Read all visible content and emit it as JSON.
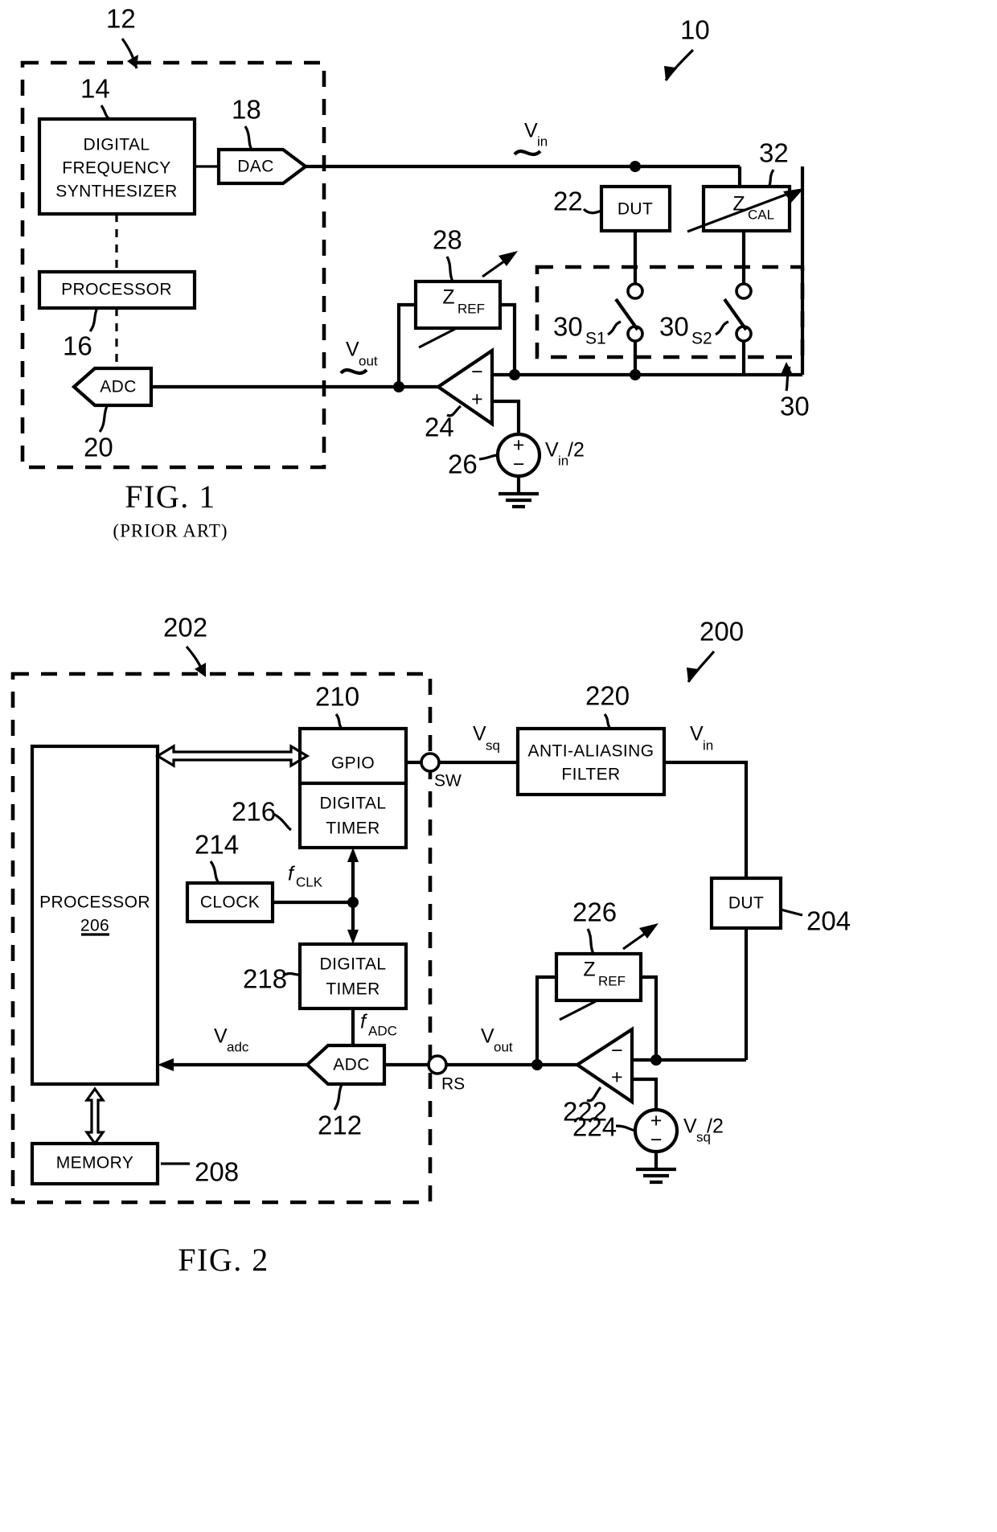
{
  "document": {
    "type": "patent-figure-sheet",
    "figures": [
      "FIG. 1",
      "FIG. 2"
    ]
  },
  "figure1": {
    "caption": "FIG. 1",
    "subcaption": "(PRIOR ART)",
    "system_ref": "10",
    "enclosure_ref": "12",
    "blocks": {
      "dfs": {
        "label_line1": "DIGITAL",
        "label_line2": "FREQUENCY",
        "label_line3": "SYNTHESIZER",
        "ref": "14"
      },
      "dac": {
        "label": "DAC",
        "ref": "18"
      },
      "processor": {
        "label": "PROCESSOR",
        "ref": "16"
      },
      "adc": {
        "label": "ADC",
        "ref": "20"
      },
      "dut": {
        "label": "DUT",
        "ref": "22"
      },
      "zcal": {
        "label": "Z",
        "sub": "CAL",
        "ref": "32"
      },
      "zref": {
        "label": "Z",
        "sub": "REF",
        "ref": "28"
      },
      "amp": {
        "ref": "24",
        "minus": "−",
        "plus": "+"
      },
      "source": {
        "ref": "26",
        "plus": "+",
        "minus": "−",
        "label": "V",
        "label_sub": "in",
        "label_tail": "/2"
      },
      "switchbank": {
        "ref": "30",
        "sw1_ref": "30",
        "sw1_sub": "S1",
        "sw2_ref": "30",
        "sw2_sub": "S2"
      }
    },
    "signals": {
      "vin": {
        "label": "V",
        "sub": "in"
      },
      "vout": {
        "label": "V",
        "sub": "out"
      }
    }
  },
  "figure2": {
    "caption": "FIG. 2",
    "system_ref": "200",
    "enclosure_ref": "202",
    "blocks": {
      "processor": {
        "label": "PROCESSOR",
        "ref": "206"
      },
      "memory": {
        "label": "MEMORY",
        "ref": "208"
      },
      "gpio": {
        "label": "GPIO",
        "ref": "210"
      },
      "timer1": {
        "label_line1": "DIGITAL",
        "label_line2": "TIMER",
        "ref": "216"
      },
      "timer2": {
        "label_line1": "DIGITAL",
        "label_line2": "TIMER",
        "ref": "218"
      },
      "clock": {
        "label": "CLOCK",
        "ref": "214"
      },
      "adc": {
        "label": "ADC",
        "ref": "212"
      },
      "filter": {
        "label_line1": "ANTI-ALIASING",
        "label_line2": "FILTER",
        "ref": "220"
      },
      "dut": {
        "label": "DUT",
        "ref": "204"
      },
      "zref": {
        "label": "Z",
        "sub": "REF",
        "ref": "226"
      },
      "amp": {
        "ref": "222",
        "minus": "−",
        "plus": "+"
      },
      "source": {
        "ref": "224",
        "plus": "+",
        "minus": "−",
        "label": "V",
        "label_sub": "sq",
        "label_tail": "/2"
      }
    },
    "signals": {
      "vsq": {
        "label": "V",
        "sub": "sq"
      },
      "vin": {
        "label": "V",
        "sub": "in"
      },
      "vout": {
        "label": "V",
        "sub": "out"
      },
      "vadc": {
        "label": "V",
        "sub": "adc"
      },
      "fclk": {
        "label": "f",
        "sub": "CLK"
      },
      "fadc": {
        "label": "f",
        "sub": "ADC"
      }
    },
    "terminals": {
      "sw": "SW",
      "rs": "RS"
    }
  }
}
